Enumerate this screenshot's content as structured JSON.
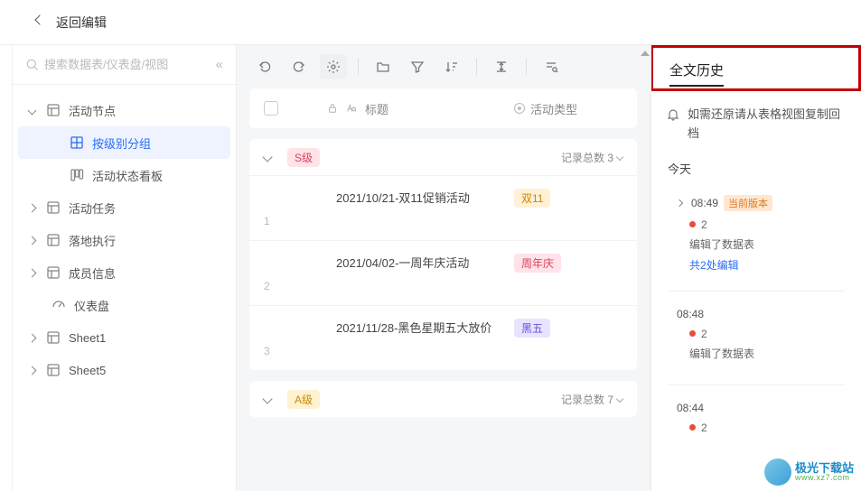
{
  "header": {
    "back_label": "返回编辑"
  },
  "sidebar": {
    "search_placeholder": "搜索数据表/仪表盘/视图",
    "items": [
      {
        "label": "活动节点"
      },
      {
        "label": "按级别分组"
      },
      {
        "label": "活动状态看板"
      },
      {
        "label": "活动任务"
      },
      {
        "label": "落地执行"
      },
      {
        "label": "成员信息"
      },
      {
        "label": "仪表盘"
      },
      {
        "label": "Sheet1"
      },
      {
        "label": "Sheet5"
      }
    ]
  },
  "table": {
    "columns": {
      "title": "标题",
      "type": "活动类型"
    },
    "groups": [
      {
        "tag": "S级",
        "count_label": "记录总数 3",
        "rows": [
          {
            "num": "1",
            "title": "2021/10/21-双11促销活动",
            "type": "双11"
          },
          {
            "num": "2",
            "title": "2021/04/02-一周年庆活动",
            "type": "周年庆"
          },
          {
            "num": "3",
            "title": "2021/11/28-黑色星期五大放价",
            "type": "黑五"
          }
        ]
      },
      {
        "tag": "A级",
        "count_label": "记录总数 7",
        "rows": []
      }
    ]
  },
  "history": {
    "header": "全文历史",
    "notice": "如需还原请从表格视图复制回档",
    "day_label": "今天",
    "items": [
      {
        "time": "08:49",
        "badge": "当前版本",
        "count": "2",
        "desc": "编辑了数据表",
        "link": "共2处编辑"
      },
      {
        "time": "08:48",
        "count": "2",
        "desc": "编辑了数据表"
      },
      {
        "time": "08:44",
        "count": "2"
      }
    ]
  },
  "watermark": {
    "name": "极光下载站",
    "url": "www.xz7.com"
  }
}
